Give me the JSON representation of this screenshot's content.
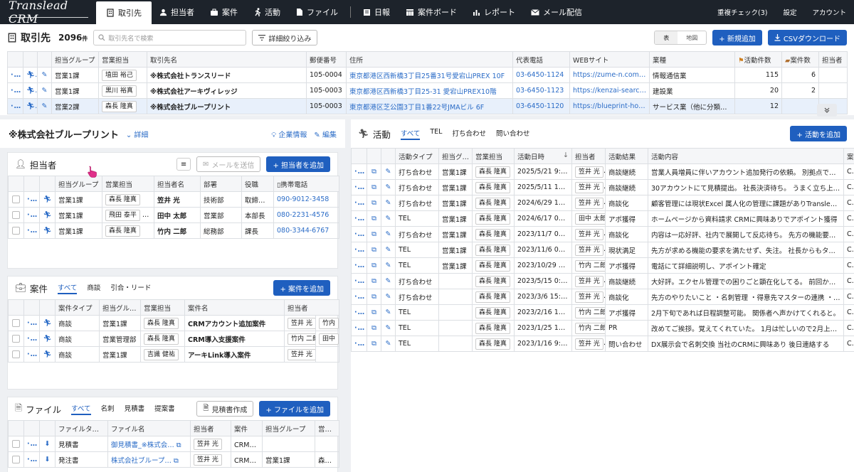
{
  "app": {
    "logo": "Translead CRM"
  },
  "nav": {
    "items": [
      "取引先",
      "担当者",
      "案件",
      "活動",
      "ファイル",
      "日報",
      "案件ボード",
      "レポート",
      "メール配信"
    ],
    "right": [
      "重複チェック(3)",
      "設定",
      "アカウント"
    ]
  },
  "toolbar": {
    "title": "取引先",
    "count": "2096",
    "count_unit": "件",
    "search_placeholder": "取引先名で検索",
    "filter": "詳細絞り込み",
    "view_table": "表",
    "view_map": "地図",
    "add": "+ 新規追加",
    "csv": "CSVダウンロード"
  },
  "main_table": {
    "headers": [
      "",
      "",
      "",
      "担当グループ",
      "営業担当",
      "取引先名",
      "郵便番号",
      "住所",
      "代表電話",
      "WEBサイト",
      "業種",
      "活動件数",
      "案件数",
      "担当者"
    ],
    "rows": [
      {
        "group": "営業1課",
        "rep": "埴田 裕己",
        "name": "※株式会社トランスリード",
        "zip": "105-0004",
        "addr": "東京都港区西新橋3丁目25番31号愛宕山PREX 10F",
        "tel": "03-6450-1124",
        "web": "https://zume-n.com/d…",
        "ind": "情報通信業",
        "act": "115",
        "deals": "6",
        "extra": ""
      },
      {
        "group": "営業1課",
        "rep": "黒川 裕真",
        "name": "※株式会社アーキヴィレッジ",
        "zip": "105-0003",
        "addr": "東京都港区西新橋3丁目25-31 愛宕山PREX10階",
        "tel": "03-6450-1123",
        "web": "https://kenzai-search.…",
        "ind": "建設業",
        "act": "20",
        "deals": "2",
        "extra": ""
      },
      {
        "group": "営業2課",
        "rep": "森長 隆真",
        "name": "※株式会社ブループリント",
        "zip": "105-0003",
        "addr": "東京都港区芝公園3丁目1番22号JMAビル 6F",
        "tel": "03-6450-1120",
        "web": "https://blueprint-hold…",
        "ind": "サービス業（他に分類…",
        "act": "12",
        "deals": "",
        "extra": ""
      }
    ]
  },
  "company": {
    "name": "※株式会社ブループリント",
    "detail": "詳細",
    "info": "企業情報",
    "edit": "編集"
  },
  "contacts": {
    "title": "担当者",
    "mail": "メールを送信",
    "add": "+ 担当者を追加",
    "headers": [
      "",
      "",
      "",
      "担当グループ",
      "営業担当",
      "担当者名",
      "部署",
      "役職",
      "携帯電話"
    ],
    "rows": [
      {
        "group": "営業1課",
        "rep": "森長 隆真",
        "rep2": "",
        "name": "笠井 光",
        "dept": "技術部",
        "role": "取締…",
        "tel": "090-9012-3458"
      },
      {
        "group": "営業1課",
        "rep": "飛田 泰平",
        "rep2": "森",
        "name": "田中 太郎",
        "dept": "営業部",
        "role": "本部長",
        "tel": "080-2231-4576"
      },
      {
        "group": "営業1課",
        "rep": "森長 隆真",
        "rep2": "",
        "name": "竹内 二郎",
        "dept": "総務部",
        "role": "課長",
        "tel": "080-3344-6767"
      }
    ]
  },
  "deals": {
    "title": "案件",
    "tabs": [
      "すべて",
      "商談",
      "引合・リード"
    ],
    "add": "+ 案件を追加",
    "headers": [
      "",
      "",
      "",
      "案件タイプ",
      "担当グル…",
      "営業担当",
      "案件名",
      "担当者"
    ],
    "rows": [
      {
        "type": "商談",
        "group": "営業1課",
        "rep": "森長 隆真",
        "name": "CRMアカウント追加案件",
        "p1": "笠井 光",
        "p2": "竹内"
      },
      {
        "type": "商談",
        "group": "営業管理部",
        "rep": "森長 隆真",
        "name": "CRM導入支援案件",
        "p1": "竹内 二郎",
        "p2": "田中"
      },
      {
        "type": "商談",
        "group": "営業1課",
        "rep": "吉識 健祐",
        "name": "アーキLink導入案件",
        "p1": "笠井 光",
        "p2": ""
      }
    ]
  },
  "files": {
    "title": "ファイル",
    "tabs": [
      "すべて",
      "名刺",
      "見積書",
      "提案書"
    ],
    "create": "見積書作成",
    "add": "+ ファイルを追加",
    "headers": [
      "",
      "",
      "",
      "ファイルタイプ",
      "ファイル名",
      "担当者",
      "案件",
      "担当グループ",
      "営業担"
    ],
    "rows": [
      {
        "type": "見積書",
        "name": "御見積書_※株式会…",
        "person": "笠井 光",
        "deal": "CRMアカ",
        "group": "",
        "rep": ""
      },
      {
        "type": "発注書",
        "name": "株式会社ブループ…",
        "person": "笠井 光",
        "deal": "CRM導入",
        "group": "営業1課",
        "rep": "森長 隆"
      }
    ]
  },
  "activities": {
    "title": "活動",
    "tabs": [
      "すべて",
      "TEL",
      "打ち合わせ",
      "問い合わせ"
    ],
    "add": "+ 活動を追加",
    "headers": [
      "",
      "",
      "",
      "活動タイプ",
      "担当グ…",
      "営業担当",
      "活動日時",
      "担当者",
      "活動結果",
      "活動内容",
      "案件"
    ],
    "rows": [
      {
        "type": "打ち合わせ",
        "group": "営業1課",
        "rep": "森長 隆真",
        "date": "2025/5/21 9:55",
        "person": "笠井 光",
        "result": "商談継続",
        "content": "営業人員増員に伴いアカウント追加発行の依頼。 別拠点での…",
        "deal": "CR"
      },
      {
        "type": "打ち合わせ",
        "group": "営業1課",
        "rep": "森長 隆真",
        "date": "2025/5/11 12:35",
        "person": "笠井 光",
        "result": "商談継続",
        "content": "30アカウントにて見積提出。 社長決済待ち。 うまく立ち上…",
        "deal": "CR"
      },
      {
        "type": "打ち合わせ",
        "group": "営業1課",
        "rep": "森長 隆真",
        "date": "2024/6/29 11:15",
        "person": "笠井 光",
        "result": "商談化",
        "content": "顧客管理には現状Excel 属人化の管理に課題がありTranslead …",
        "deal": "CR"
      },
      {
        "type": "TEL",
        "group": "営業1課",
        "rep": "森長 隆真",
        "date": "2024/6/17 00:00",
        "person": "田中 太郎",
        "result": "アポ獲得",
        "content": "ホームページから資料請求 CRMに興味ありでアポイント獲得",
        "deal": "CR"
      },
      {
        "type": "打ち合わせ",
        "group": "営業1課",
        "rep": "森長 隆真",
        "date": "2023/11/7 00:00",
        "person": "笠井 光",
        "result": "商談化",
        "content": "内容は一応好評、社内で展開して反応待ち。 先方の機能要望…",
        "deal": "CR"
      },
      {
        "type": "TEL",
        "group": "営業1課",
        "rep": "森長 隆真",
        "date": "2023/11/6 00:00",
        "person": "笠井 光",
        "result": "現状満足",
        "content": "先方が求める機能の要求を満たせず、失注。 社長からもタイ…",
        "deal": "CR"
      },
      {
        "type": "TEL",
        "group": "営業1課",
        "rep": "森長 隆真",
        "date": "2023/10/29 00:00",
        "person": "竹内 二郎",
        "result": "アポ獲得",
        "content": "電話にて詳細説明し、アポイント確定",
        "deal": "CR"
      },
      {
        "type": "打ち合わせ",
        "group": "",
        "rep": "森長 隆真",
        "date": "2023/5/15 0:00",
        "person": "笠井 光",
        "result": "商談継続",
        "content": "大好評。エクセル管理での困りごと顕在化してる。 前回から…",
        "deal": "CR"
      },
      {
        "type": "打ち合わせ",
        "group": "",
        "rep": "森長 隆真",
        "date": "2023/3/6 15:00",
        "person": "笠井 光",
        "result": "商談化",
        "content": "先方のやりたいこと ・名刺管理 ・得意先マスターの連携 ・…",
        "deal": "CR"
      },
      {
        "type": "TEL",
        "group": "",
        "rep": "森長 隆真",
        "date": "2023/2/16 10:00",
        "person": "竹内 二郎",
        "result": "アポ獲得",
        "content": "2月下旬であれば日程調整可能。 関係者へ声かけてくれると。",
        "deal": "CR"
      },
      {
        "type": "TEL",
        "group": "",
        "rep": "森長 隆真",
        "date": "2023/1/25 10:00",
        "person": "竹内 二郎",
        "result": "PR",
        "content": "改めてご挨拶。覚えてくれていた。 1月は忙しいので2月上旬…",
        "deal": "CR"
      },
      {
        "type": "TEL",
        "group": "",
        "rep": "森長 隆真",
        "date": "2023/1/16 9:00",
        "person": "笠井 光",
        "result": "問い合わせ",
        "content": "DX展示会で名刺交換 当社のCRMに興味あり 後日連絡する",
        "deal": "CR"
      }
    ]
  }
}
